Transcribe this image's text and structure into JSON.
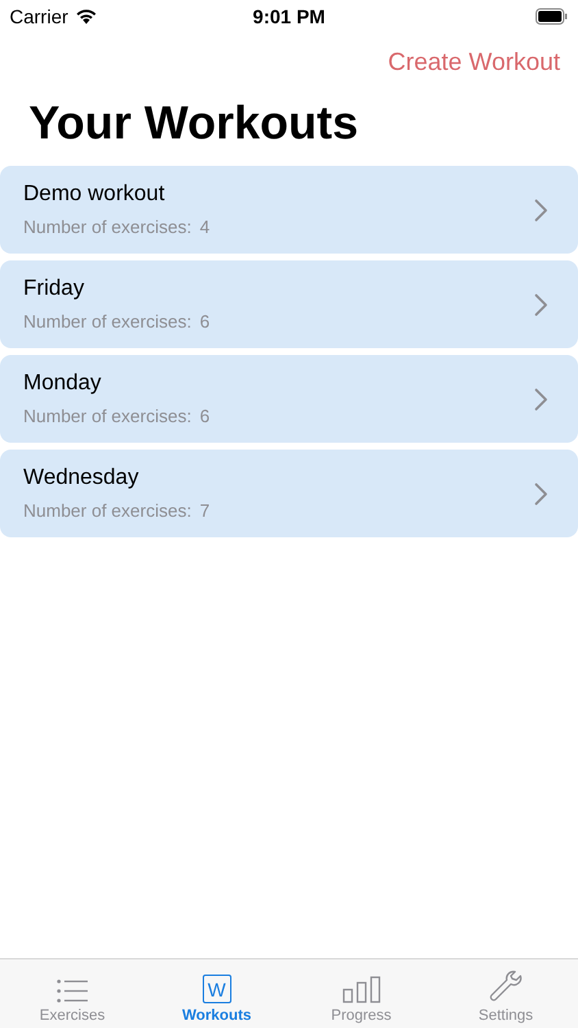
{
  "status_bar": {
    "carrier": "Carrier",
    "time": "9:01 PM"
  },
  "nav": {
    "action": "Create Workout"
  },
  "title": "Your Workouts",
  "workouts": [
    {
      "name": "Demo workout",
      "label": "Number of exercises:",
      "count": "4"
    },
    {
      "name": "Friday",
      "label": "Number of exercises:",
      "count": "6"
    },
    {
      "name": "Monday",
      "label": "Number of exercises:",
      "count": "6"
    },
    {
      "name": "Wednesday",
      "label": "Number of exercises:",
      "count": "7"
    }
  ],
  "tabs": [
    {
      "kind": "list",
      "label": "Exercises",
      "selected": false
    },
    {
      "kind": "letter",
      "icon_text": "W",
      "label": "Workouts",
      "selected": true
    },
    {
      "kind": "bars",
      "label": "Progress",
      "selected": false
    },
    {
      "kind": "wrench",
      "label": "Settings",
      "selected": false
    }
  ]
}
